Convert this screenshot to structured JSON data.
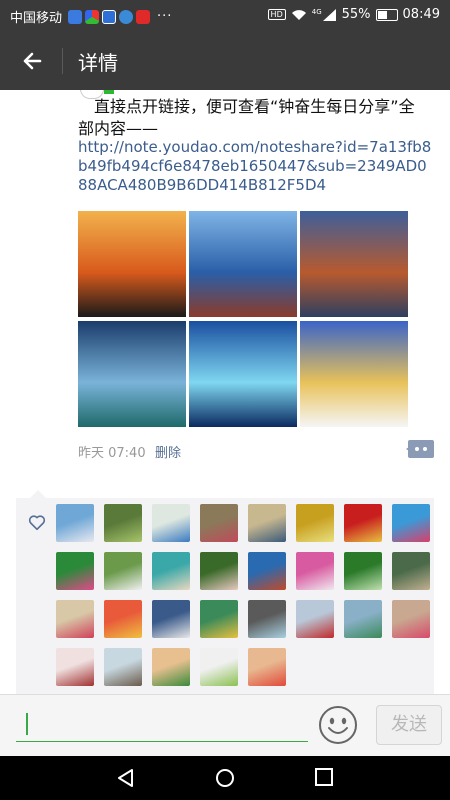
{
  "status_bar": {
    "carrier": "中国移动",
    "more": "···",
    "network": "HD",
    "signal_label": "4G",
    "battery": "55%",
    "battery_level": 0.55,
    "time": "08:49"
  },
  "app_bar": {
    "title": "详情",
    "back_icon": "back-arrow-icon"
  },
  "post": {
    "text": "直接点开链接，便可查看“钟奋生每日分享”全部内容——",
    "link": "http://note.youdao.com/noteshare?id=7a13fb8b49fb494cf6e8478eb1650447&sub=2349AD088ACA480B9B6DD414B812F5D4",
    "photos": [
      {
        "name": "crane-at-sunset",
        "colors": [
          "#f2b24d",
          "#d85a1c",
          "#1a1a1a"
        ]
      },
      {
        "name": "lighthouse-on-coast",
        "colors": [
          "#7fb4e6",
          "#2a5fa8",
          "#8a3b2a"
        ]
      },
      {
        "name": "canal-houses-at-dusk",
        "colors": [
          "#3d5f9a",
          "#b85a2e",
          "#2e3f60"
        ]
      },
      {
        "name": "city-skyline-night",
        "colors": [
          "#1b3d6b",
          "#7ab3d9",
          "#1e6a6a"
        ]
      },
      {
        "name": "fireworks-over-city",
        "colors": [
          "#1a4fa0",
          "#7fd7f0",
          "#0a2a60"
        ]
      },
      {
        "name": "white-town-castle",
        "colors": [
          "#3a64c8",
          "#e8c25a",
          "#f5f5f5"
        ]
      }
    ],
    "time": "昨天 07:40",
    "delete_label": "删除"
  },
  "likes": {
    "avatar_colors": [
      [
        "#6fa8d6",
        "#e8e8f0"
      ],
      [
        "#5a7a3a",
        "#a8c46a"
      ],
      [
        "#dfe8e0",
        "#3a7ac0"
      ],
      [
        "#8a7a5a",
        "#c04a5a"
      ],
      [
        "#c8b890",
        "#3a5a7a"
      ],
      [
        "#c8a020",
        "#e8e080"
      ],
      [
        "#c81e1e",
        "#e8c040"
      ],
      [
        "#3a9ad8",
        "#d8406a"
      ],
      [
        "#2a8a3a",
        "#e04a8a"
      ],
      [
        "#6a9a4a",
        "#f0f0f0"
      ],
      [
        "#3aa8a8",
        "#e8d8c0"
      ],
      [
        "#3a6a2a",
        "#e8c8c0"
      ],
      [
        "#2a6ab0",
        "#c04a2a"
      ],
      [
        "#d85aa0",
        "#f0e8f0"
      ],
      [
        "#2a7a2a",
        "#c0e0b0"
      ],
      [
        "#4a6a4a",
        "#c0b090"
      ],
      [
        "#d8c8a8",
        "#d0405a"
      ],
      [
        "#e85a3a",
        "#f0c040"
      ],
      [
        "#3a5a8a",
        "#e8e8e8"
      ],
      [
        "#3a8a5a",
        "#e8c040"
      ],
      [
        "#5a5a5a",
        "#a8d0e0"
      ],
      [
        "#b8c8d8",
        "#c02a2a"
      ],
      [
        "#8ab0c8",
        "#3a8a5a"
      ],
      [
        "#c8a890",
        "#d84a6a"
      ],
      [
        "#f0e0e0",
        "#a03030"
      ],
      [
        "#c8d8e0",
        "#6a5a4a"
      ],
      [
        "#e8c090",
        "#3a8a3a"
      ],
      [
        "#f0f0f0",
        "#8ac050"
      ],
      [
        "#e8b890",
        "#e04a3a"
      ]
    ]
  },
  "input_bar": {
    "placeholder": "",
    "emoji_icon": "smiley-face-icon",
    "send_label": "发送"
  },
  "nav_bar": {
    "icons": [
      "nav-back-icon",
      "nav-home-icon",
      "nav-recents-icon"
    ]
  }
}
